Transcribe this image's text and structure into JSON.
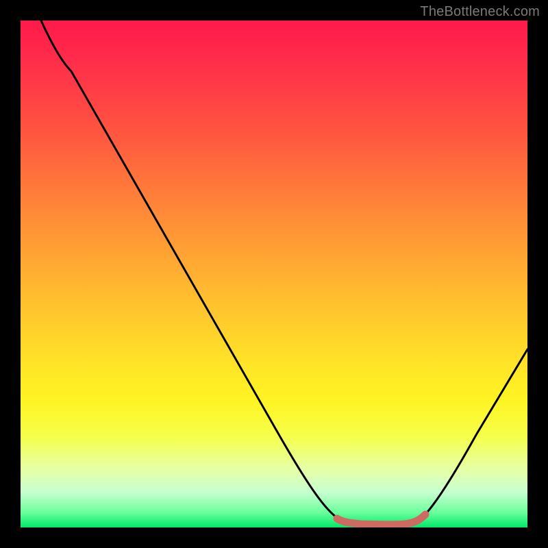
{
  "watermark": "TheBottleneck.com",
  "chart_data": {
    "type": "line",
    "title": "",
    "xlabel": "",
    "ylabel": "",
    "xlim": [
      0,
      100
    ],
    "ylim": [
      0,
      100
    ],
    "x": [
      4,
      10,
      20,
      30,
      40,
      50,
      60,
      63,
      67,
      72,
      76,
      78,
      84,
      90,
      100
    ],
    "y": [
      100,
      90,
      75,
      60,
      45,
      30,
      12,
      5,
      1,
      0,
      0,
      1,
      8,
      18,
      35
    ],
    "highlight_range_x": [
      63,
      78
    ],
    "highlight_color": "#cd6b62",
    "gradient_colors": {
      "top": "#ff1a4b",
      "mid": "#ffe228",
      "bottom": "#00e86a"
    }
  }
}
